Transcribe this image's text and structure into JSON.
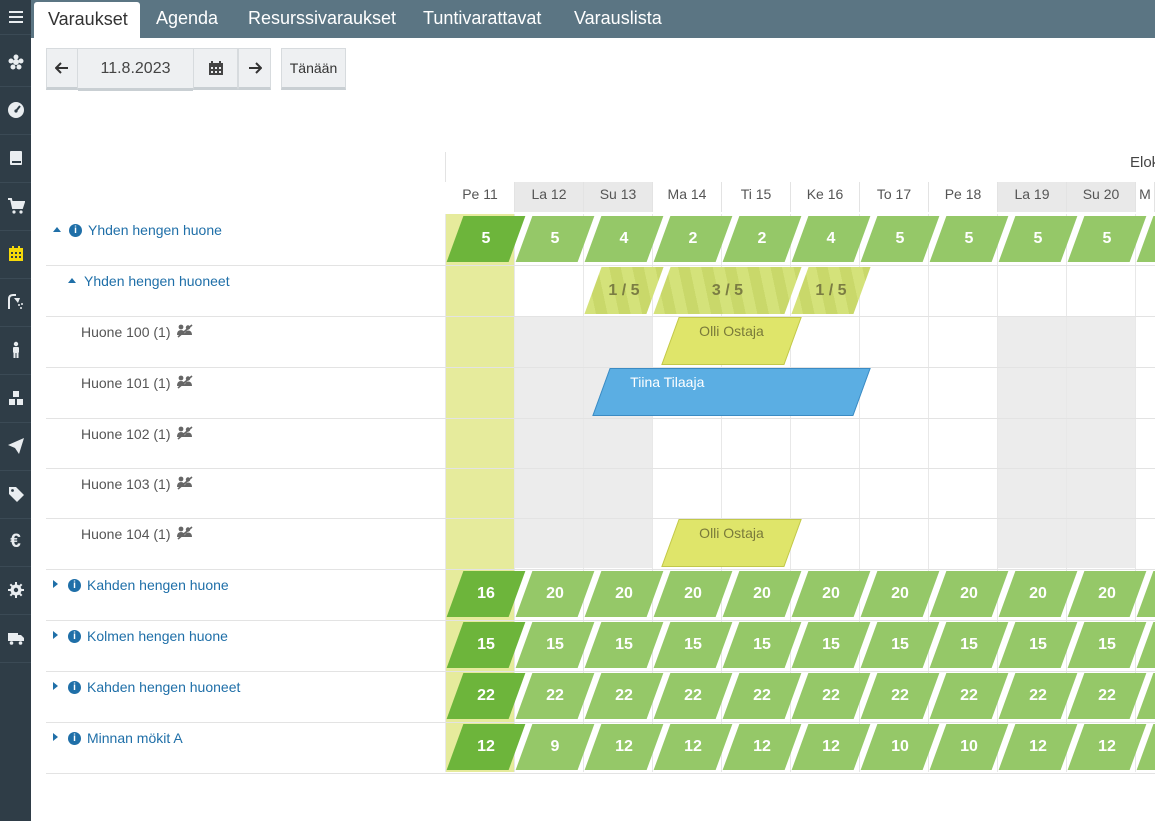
{
  "top_tabs": [
    {
      "label": "Varaukset"
    },
    {
      "label": "Agenda"
    },
    {
      "label": "Resurssivaraukset"
    },
    {
      "label": "Tuntivarattavat"
    },
    {
      "label": "Varauslista"
    }
  ],
  "toolbar": {
    "date_value": "11.8.2023",
    "today_label": "Tänään"
  },
  "calendar": {
    "month_label": "Elok",
    "days": [
      {
        "label": "Pe 11",
        "weekend": false
      },
      {
        "label": "La 12",
        "weekend": true
      },
      {
        "label": "Su 13",
        "weekend": true
      },
      {
        "label": "Ma 14",
        "weekend": false
      },
      {
        "label": "Ti 15",
        "weekend": false
      },
      {
        "label": "Ke 16",
        "weekend": false
      },
      {
        "label": "To 17",
        "weekend": false
      },
      {
        "label": "Pe 18",
        "weekend": false
      },
      {
        "label": "La 19",
        "weekend": true
      },
      {
        "label": "Su 20",
        "weekend": true
      },
      {
        "label": "M",
        "weekend": false
      }
    ]
  },
  "rows": [
    {
      "label": "Yhden hengen huone",
      "kind": "category",
      "expanded": true,
      "availability": [
        "5",
        "5",
        "4",
        "2",
        "2",
        "4",
        "5",
        "5",
        "5",
        "5",
        ""
      ]
    },
    {
      "label": "Yhden hengen huoneet",
      "kind": "subcategory",
      "expanded": true,
      "occupancy": [
        {
          "start": 2,
          "span": 1,
          "text": "1 / 5"
        },
        {
          "start": 3,
          "span": 2,
          "text": "3 / 5"
        },
        {
          "start": 5,
          "span": 1,
          "text": "1 / 5"
        }
      ]
    },
    {
      "label": "Huone 100 (1)",
      "kind": "room",
      "bookings": [
        {
          "start": 3,
          "span": 2,
          "text": "Olli Ostaja",
          "color": "yellow"
        }
      ]
    },
    {
      "label": "Huone 101 (1)",
      "kind": "room",
      "bookings": [
        {
          "start": 2,
          "span": 4,
          "text": "Tiina Tilaaja",
          "color": "blue"
        }
      ]
    },
    {
      "label": "Huone 102 (1)",
      "kind": "room",
      "bookings": []
    },
    {
      "label": "Huone 103 (1)",
      "kind": "room",
      "bookings": []
    },
    {
      "label": "Huone 104 (1)",
      "kind": "room",
      "bookings": [
        {
          "start": 3,
          "span": 2,
          "text": "Olli Ostaja",
          "color": "yellow"
        }
      ]
    },
    {
      "label": "Kahden hengen huone",
      "kind": "category",
      "expanded": false,
      "availability": [
        "16",
        "20",
        "20",
        "20",
        "20",
        "20",
        "20",
        "20",
        "20",
        "20",
        ""
      ]
    },
    {
      "label": "Kolmen hengen huone",
      "kind": "category",
      "expanded": false,
      "availability": [
        "15",
        "15",
        "15",
        "15",
        "15",
        "15",
        "15",
        "15",
        "15",
        "15",
        ""
      ]
    },
    {
      "label": "Kahden hengen huoneet",
      "kind": "category",
      "expanded": false,
      "availability": [
        "22",
        "22",
        "22",
        "22",
        "22",
        "22",
        "22",
        "22",
        "22",
        "22",
        ""
      ]
    },
    {
      "label": "Minnan mökit A",
      "kind": "category",
      "expanded": false,
      "availability": [
        "12",
        "9",
        "12",
        "12",
        "12",
        "12",
        "10",
        "10",
        "12",
        "12",
        ""
      ]
    }
  ],
  "colors": {
    "sidebar": "#2f3d47",
    "topbar": "#5b7583",
    "available": "#95c868",
    "available_today": "#6db53b",
    "today_column": "#e6eb9c",
    "booking_yellow": "#dfe56a",
    "booking_blue": "#5baee3",
    "link_blue": "#1f6fa8"
  },
  "sidebar_icons": [
    "menu-icon",
    "flower-icon",
    "dashboard-icon",
    "book-icon",
    "cart-icon",
    "calendar-icon",
    "shower-icon",
    "person-icon",
    "cubes-icon",
    "paper-plane-icon",
    "tag-icon",
    "euro-icon",
    "gear-icon",
    "truck-icon"
  ]
}
